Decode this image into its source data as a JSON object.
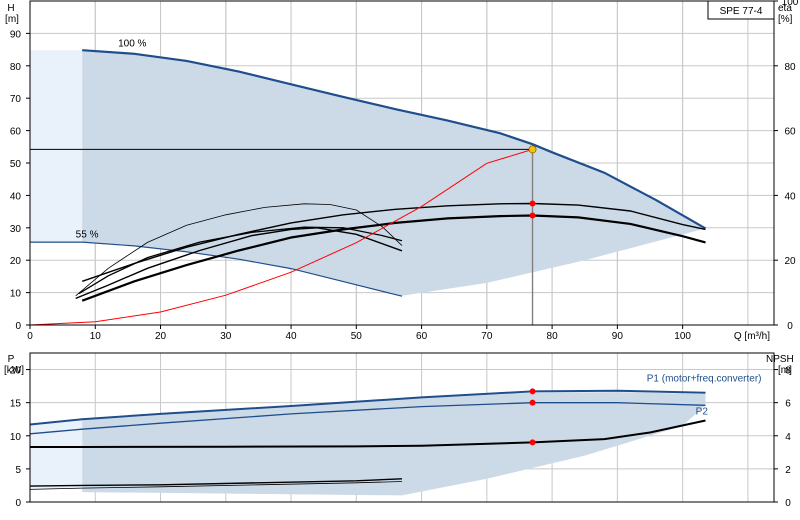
{
  "chart_data": [
    {
      "type": "line",
      "title": "SPE 77-4",
      "xlabel": "Q [m³/h]",
      "ylabel": "H\n[m]",
      "y2label": "eta\n[%]",
      "xlim": [
        0,
        114
      ],
      "ylim": [
        0,
        100
      ],
      "y2lim": [
        0,
        100
      ],
      "xticks": [
        0,
        10,
        20,
        30,
        40,
        50,
        60,
        70,
        80,
        90,
        100
      ],
      "yticks": [
        0,
        10,
        20,
        30,
        40,
        50,
        60,
        70,
        80,
        90
      ],
      "y2ticks": [
        0,
        20,
        40,
        60,
        80,
        100
      ],
      "grid": true,
      "annotations": [
        {
          "text": "100 %",
          "x": 13.5,
          "y": 86
        },
        {
          "text": "55 %",
          "x": 7,
          "y": 27
        }
      ],
      "operating_point": {
        "Q": 77,
        "H": 54.2
      },
      "speed_curves": [
        {
          "name": "100 %",
          "x": [
            8,
            16,
            24,
            32,
            40,
            48,
            56,
            64,
            72,
            77,
            80,
            88,
            96,
            103.5
          ],
          "y": [
            84.8,
            83.7,
            81.5,
            78.2,
            74.3,
            70.4,
            66.6,
            63.1,
            59.2,
            55.8,
            53.3,
            47.0,
            38.5,
            29.8
          ]
        },
        {
          "name": "55 %",
          "x": [
            0,
            8,
            16,
            24,
            32,
            40,
            48,
            57
          ],
          "y": [
            25.6,
            25.6,
            24.4,
            22.6,
            20.3,
            17.4,
            13.4,
            8.9
          ]
        }
      ],
      "region_lower_boundary": {
        "x": [
          57,
          70,
          85,
          103.5
        ],
        "y": [
          9,
          13,
          20,
          29.8
        ]
      },
      "system_curve": {
        "x": [
          0,
          10,
          20,
          30,
          40,
          50,
          60,
          70,
          77
        ],
        "y": [
          0,
          1.0,
          4.0,
          9.2,
          16.3,
          25.4,
          36.6,
          49.9,
          54.2
        ]
      },
      "eta_curves": [
        {
          "x": [
            8,
            16,
            24,
            32,
            40,
            48,
            56,
            64,
            72,
            77,
            84,
            92,
            100,
            103.5
          ],
          "y": [
            13.5,
            19,
            24,
            28,
            31.5,
            34,
            35.7,
            36.8,
            37.4,
            37.5,
            37,
            35.2,
            31,
            29.5
          ]
        },
        {
          "x": [
            8,
            16,
            24,
            32,
            40,
            48,
            56,
            64,
            72,
            77,
            84,
            92,
            100,
            103.5
          ],
          "y": [
            7.5,
            13.5,
            18.5,
            23,
            27,
            29.5,
            31.5,
            32.9,
            33.6,
            33.8,
            33.2,
            31.2,
            27.4,
            25.5
          ]
        },
        {
          "x": [
            7.5,
            12,
            18,
            26,
            34,
            42,
            48,
            54,
            57
          ],
          "y": [
            9.7,
            15.2,
            20.8,
            25.6,
            28.6,
            30.2,
            30.0,
            27.6,
            26.0
          ]
        },
        {
          "x": [
            7,
            12,
            18,
            26,
            34,
            40,
            44,
            50,
            57
          ],
          "y": [
            8.2,
            12.3,
            17.5,
            23.0,
            27.6,
            29.5,
            30.0,
            28.0,
            22.9
          ]
        },
        {
          "x": [
            7,
            12,
            18,
            24,
            30,
            36,
            42,
            46,
            50,
            54,
            57
          ],
          "y": [
            9.0,
            17.5,
            25.5,
            30.8,
            34.0,
            36.3,
            37.4,
            37.2,
            35.5,
            30.3,
            24.5
          ]
        }
      ],
      "marker_points": [
        {
          "Q": 77,
          "value": 54.2,
          "color": "#f5c400"
        },
        {
          "Q": 77,
          "value": 37.5,
          "color": "#ff0000"
        },
        {
          "Q": 77,
          "value": 33.8,
          "color": "#ff0000"
        }
      ]
    },
    {
      "type": "line",
      "xlabel": "",
      "ylabel": "P\n[kW]",
      "y2label": "NPSH\n[m]",
      "xlim": [
        0,
        114
      ],
      "ylim": [
        0,
        22.5
      ],
      "y2lim": [
        0,
        9
      ],
      "yticks": [
        0,
        5,
        10,
        15,
        20
      ],
      "y2ticks": [
        0,
        2,
        4,
        6,
        8
      ],
      "grid": true,
      "series": [
        {
          "name": "P1 (motor+freq.converter)",
          "x": [
            0,
            8,
            20,
            40,
            60,
            77,
            90,
            103.5
          ],
          "y": [
            11.7,
            12.5,
            13.3,
            14.5,
            15.8,
            16.7,
            16.8,
            16.5
          ]
        },
        {
          "name": "P2",
          "x": [
            0,
            8,
            20,
            40,
            60,
            77,
            90,
            103.5
          ],
          "y": [
            10.3,
            11.0,
            11.9,
            13.3,
            14.4,
            15.0,
            15.0,
            14.6
          ]
        },
        {
          "name": "",
          "x": [
            0,
            8,
            30,
            50,
            60,
            77,
            88,
            95,
            103.5
          ],
          "y": [
            8.3,
            8.3,
            8.35,
            8.4,
            8.5,
            9.0,
            9.5,
            10.5,
            12.3
          ]
        },
        {
          "name": "",
          "x": [
            0,
            8,
            20,
            35,
            50,
            57
          ],
          "y": [
            2.4,
            2.5,
            2.6,
            2.9,
            3.2,
            3.5
          ]
        },
        {
          "name": "",
          "x": [
            0,
            8,
            20,
            35,
            50,
            57
          ],
          "y": [
            1.9,
            2.1,
            2.3,
            2.6,
            2.9,
            3.1
          ]
        }
      ],
      "region": {
        "upper": {
          "x": [
            8,
            20,
            40,
            60,
            77,
            90,
            103.5
          ],
          "y": [
            12.4,
            13.2,
            14.4,
            15.7,
            16.5,
            16.6,
            16.3
          ]
        },
        "lower": {
          "x": [
            57,
            70,
            85,
            100,
            103.5
          ],
          "y": [
            1.0,
            3.5,
            7.0,
            11.5,
            14.6
          ]
        }
      },
      "marker_points": [
        {
          "Q": 77,
          "value": 16.7,
          "color": "#ff0000"
        },
        {
          "Q": 77,
          "value": 15.0,
          "color": "#ff0000"
        },
        {
          "Q": 77,
          "value": 9.0,
          "color": "#ff0000"
        }
      ]
    }
  ]
}
